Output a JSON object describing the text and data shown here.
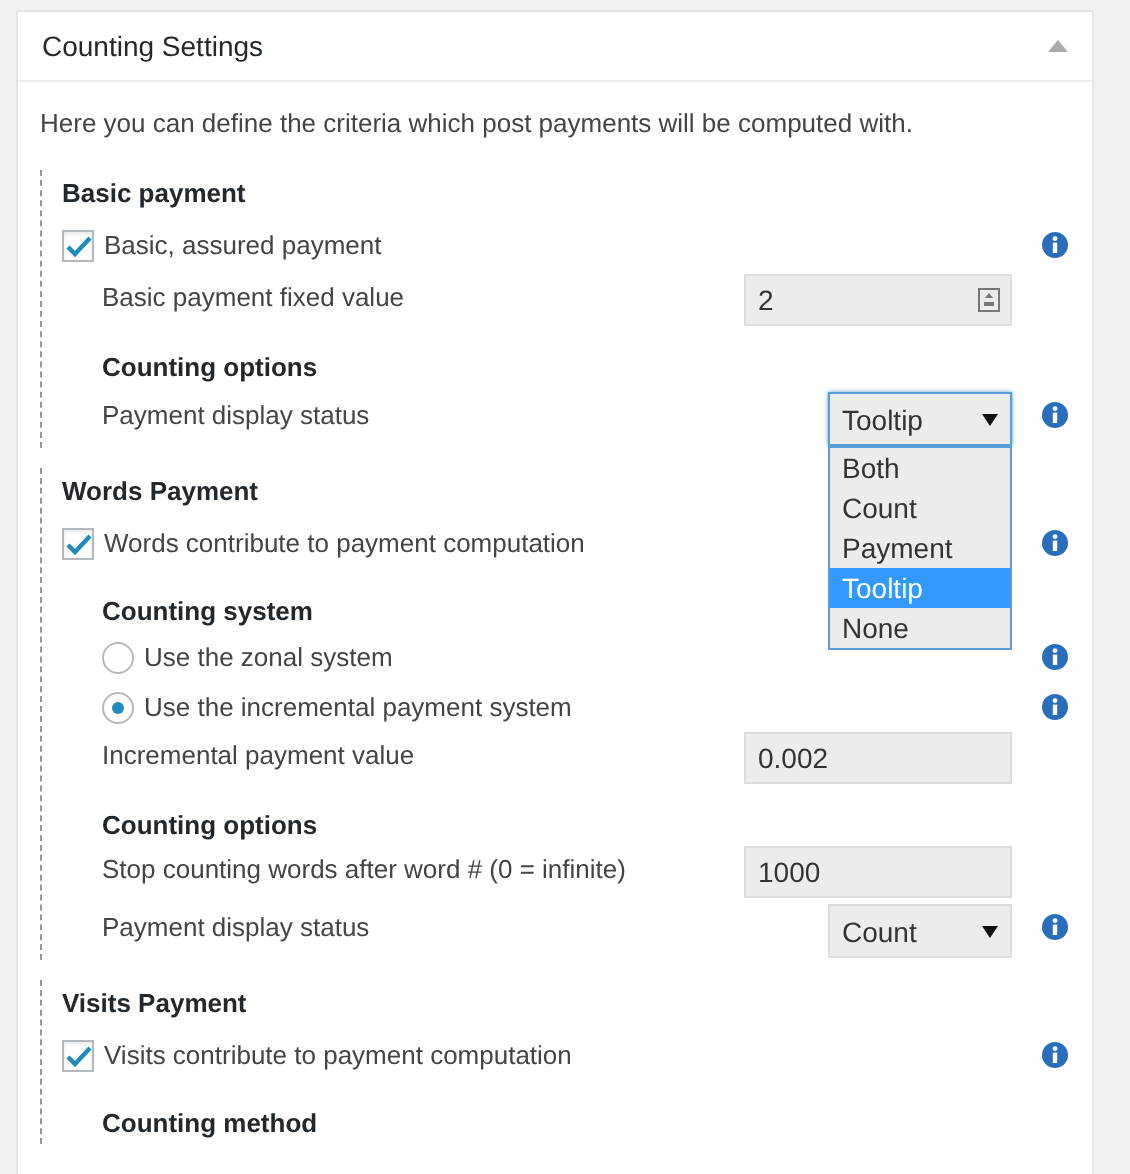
{
  "panel": {
    "title": "Counting Settings",
    "expanded": true
  },
  "description": "Here you can define the criteria which post payments will be computed with.",
  "sections": [
    {
      "title": "Basic payment",
      "rows": [
        {
          "kind": "checkbox",
          "label": "Basic, assured payment",
          "checked": true,
          "info": true
        },
        {
          "kind": "field",
          "label": "Basic payment fixed value",
          "value": "2",
          "spinner": true
        },
        {
          "kind": "heading",
          "label": "Counting options"
        },
        {
          "kind": "select",
          "label": "Payment display status",
          "value": "Tooltip",
          "info": true,
          "open": true,
          "options": [
            {
              "label": "Both",
              "selected": false
            },
            {
              "label": "Count",
              "selected": false
            },
            {
              "label": "Payment",
              "selected": false
            },
            {
              "label": "Tooltip",
              "selected": true
            },
            {
              "label": "None",
              "selected": false
            }
          ]
        }
      ]
    },
    {
      "title": "Words Payment",
      "rows": [
        {
          "kind": "checkbox",
          "label": "Words contribute to payment computation",
          "checked": true,
          "info": true
        },
        {
          "kind": "heading",
          "label": "Counting system"
        },
        {
          "kind": "radio",
          "label": "Use the zonal system",
          "selected": false,
          "info": true
        },
        {
          "kind": "radio",
          "label": "Use the incremental payment system",
          "selected": true,
          "info": true
        },
        {
          "kind": "field",
          "label": "Incremental payment value",
          "value": "0.002"
        },
        {
          "kind": "heading",
          "label": "Counting options"
        },
        {
          "kind": "field",
          "label": "Stop counting words after word # (0 = infinite)",
          "value": "1000"
        },
        {
          "kind": "select",
          "label": "Payment display status",
          "value": "Count",
          "info": true,
          "open": false
        }
      ]
    },
    {
      "title": "Visits Payment",
      "rows": [
        {
          "kind": "checkbox",
          "label": "Visits contribute to payment computation",
          "checked": true,
          "info": true
        },
        {
          "kind": "heading",
          "label": "Counting method"
        }
      ]
    }
  ]
}
